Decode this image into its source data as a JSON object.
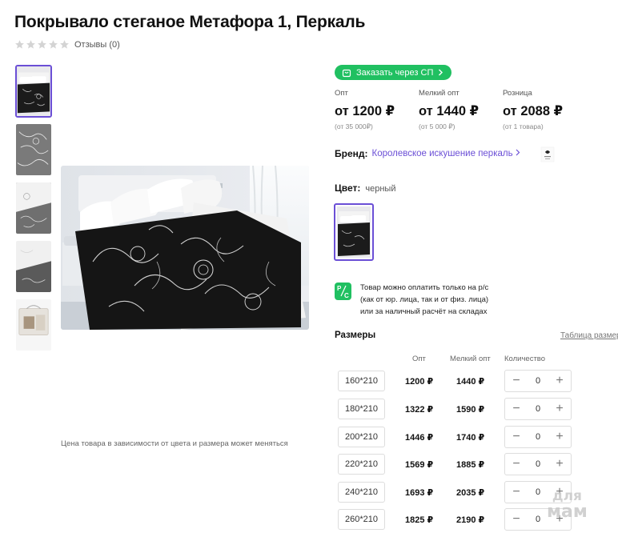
{
  "product": {
    "title": "Покрывало стеганое Метафора 1, Перкаль",
    "reviews_label": "Отзывы (0)",
    "rating_stars": 0
  },
  "gallery": {
    "note": "Цена товара в зависимости от цвета и размера может меняться"
  },
  "order_button": {
    "label": "Заказать через СП"
  },
  "prices": [
    {
      "label": "Опт",
      "value": "от 1200 ₽",
      "sub": "(от 35 000₽)"
    },
    {
      "label": "Мелкий опт",
      "value": "от 1440 ₽",
      "sub": "(от 5 000 ₽)"
    },
    {
      "label": "Розница",
      "value": "от 2088 ₽",
      "sub": "(от 1 товара)"
    }
  ],
  "brand": {
    "label": "Бренд:",
    "name": "Королевское искушение перкаль"
  },
  "color": {
    "label": "Цвет:",
    "value": "черный"
  },
  "payment_note": {
    "icon_text": "Р/С",
    "lines": [
      "Товар можно оплатить только на р/с",
      "(как от юр. лица, так и от физ. лица)",
      "или за наличный расчёт на складах"
    ]
  },
  "sizes": {
    "title": "Размеры",
    "table_link": "Таблица размеров",
    "headers": {
      "wholesale": "Опт",
      "small_wholesale": "Мелкий опт",
      "quantity": "Количество"
    },
    "rows": [
      {
        "size": "160*210",
        "wholesale": "1200 ₽",
        "small_wholesale": "1440 ₽",
        "quantity": "0"
      },
      {
        "size": "180*210",
        "wholesale": "1322 ₽",
        "small_wholesale": "1590 ₽",
        "quantity": "0"
      },
      {
        "size": "200*210",
        "wholesale": "1446 ₽",
        "small_wholesale": "1740 ₽",
        "quantity": "0"
      },
      {
        "size": "220*210",
        "wholesale": "1569 ₽",
        "small_wholesale": "1885 ₽",
        "quantity": "0"
      },
      {
        "size": "240*210",
        "wholesale": "1693 ₽",
        "small_wholesale": "2035 ₽",
        "quantity": "0"
      },
      {
        "size": "260*210",
        "wholesale": "1825 ₽",
        "small_wholesale": "2190 ₽",
        "quantity": "0"
      }
    ]
  },
  "watermark": {
    "line1": "для",
    "line2": "мам"
  },
  "colors": {
    "accent": "#6b4fd6",
    "green": "#20c061"
  }
}
